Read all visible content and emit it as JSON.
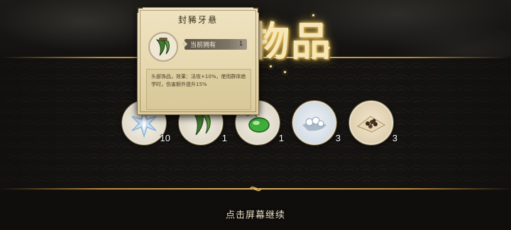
{
  "header": {
    "title_glyphs": "物品"
  },
  "tooltip": {
    "item_name": "封豨牙悬",
    "owned_label": "当前拥有",
    "owned_count": "1",
    "icon": "green-fang-pendant-icon",
    "description": "头部饰品，效果：法攻+10%，使用群体绝学时，伤害额外提升15%"
  },
  "items": [
    {
      "icon": "ice-crystal-star-icon",
      "count": "10"
    },
    {
      "icon": "green-fang-pendant-icon",
      "count": "1"
    },
    {
      "icon": "jade-gourd-icon",
      "count": "1"
    },
    {
      "icon": "snowy-stones-icon",
      "count": "3"
    },
    {
      "icon": "seed-pile-icon",
      "count": "3"
    }
  ],
  "footer": {
    "continue_text": "点击屏幕继续"
  },
  "colors": {
    "gold": "#d8ae5c",
    "parchment": "#e6d7ae",
    "background": "#0f0e0c"
  }
}
